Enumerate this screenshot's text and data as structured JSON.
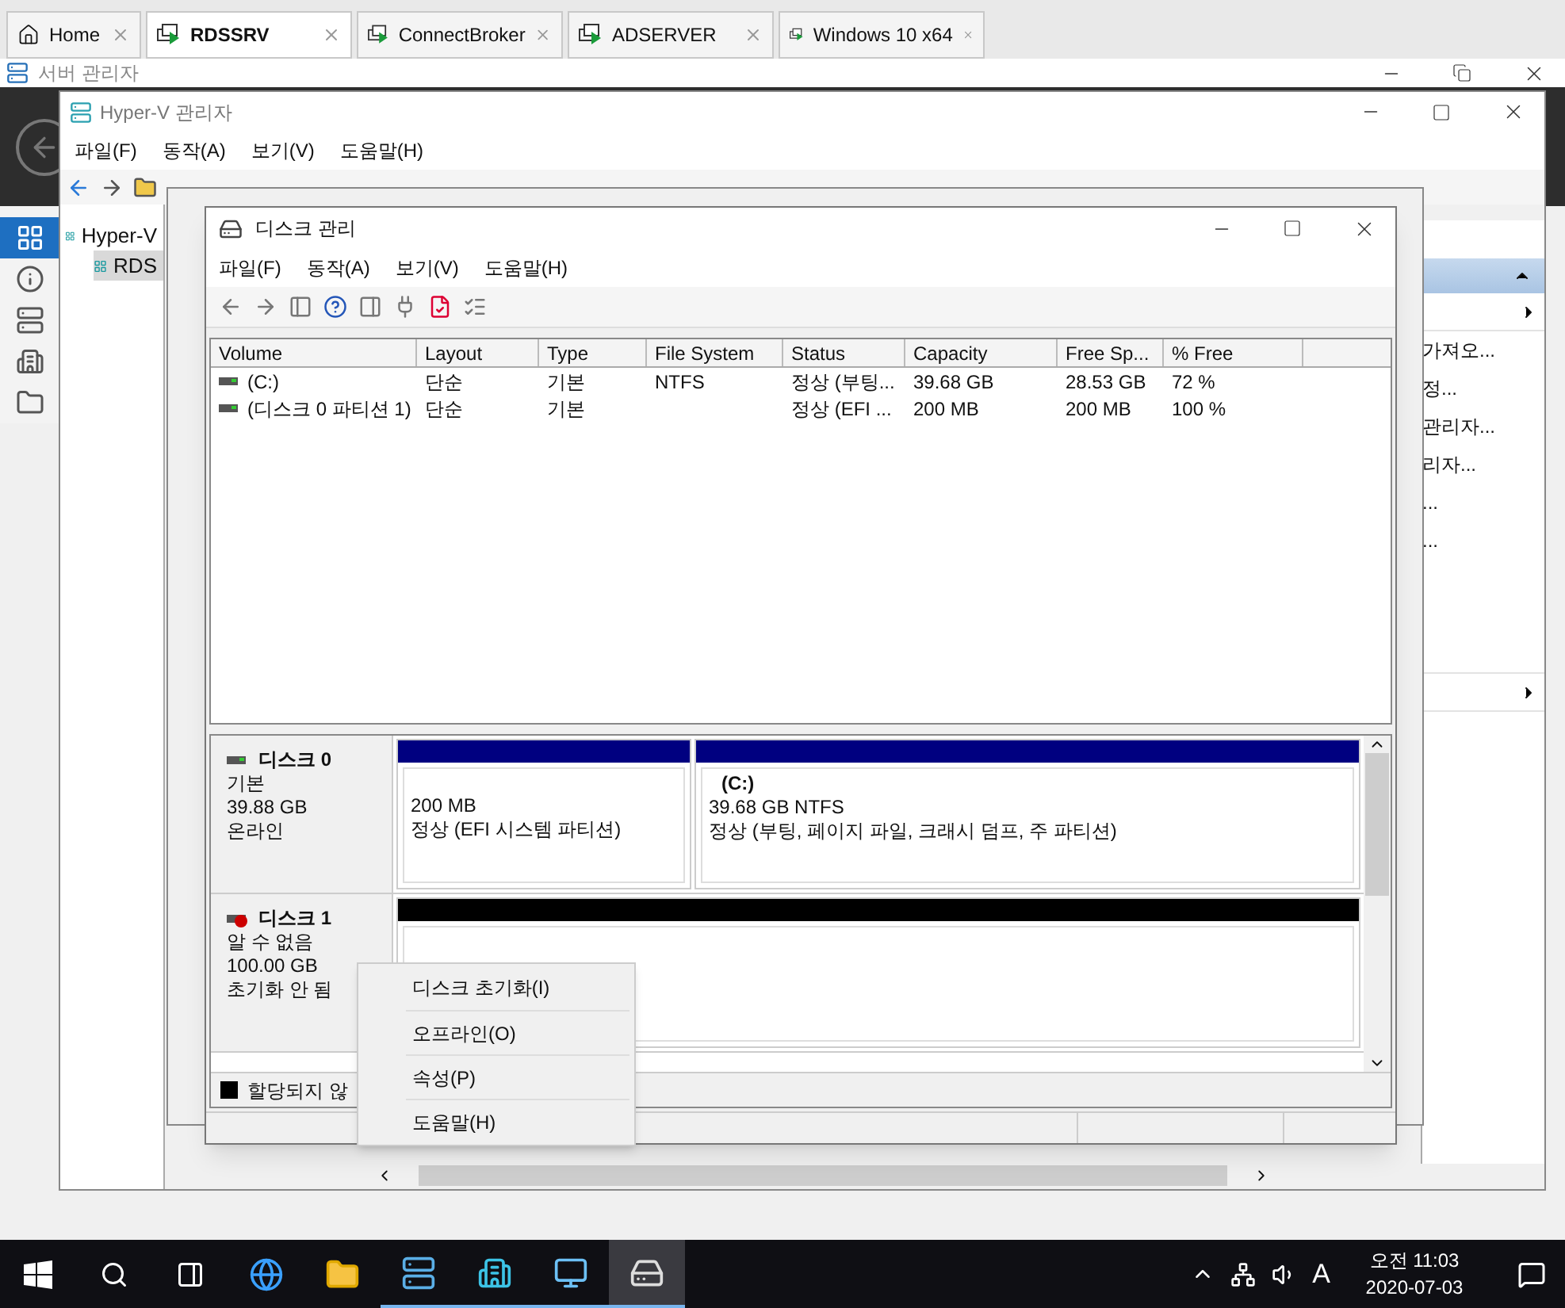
{
  "tabs": [
    {
      "label": "Home",
      "kind": "home",
      "selected": false
    },
    {
      "label": "RDSSRV",
      "kind": "vm",
      "selected": true
    },
    {
      "label": "ConnectBroker",
      "kind": "vm",
      "selected": false
    },
    {
      "label": "ADSERVER",
      "kind": "vm",
      "selected": false
    },
    {
      "label": "Windows 10 x64",
      "kind": "vm",
      "selected": false
    }
  ],
  "server_manager": {
    "title": "서버 관리자",
    "nav": [
      {
        "kind": "dashboard",
        "selected": true
      },
      {
        "kind": "local",
        "selected": false
      },
      {
        "kind": "all",
        "selected": false
      },
      {
        "kind": "role",
        "selected": false
      },
      {
        "kind": "files",
        "selected": false
      }
    ]
  },
  "hyperv": {
    "title": "Hyper-V 관리자",
    "menu": [
      "파일(F)",
      "동작(A)",
      "보기(V)",
      "도움말(H)"
    ],
    "tree": [
      {
        "label": "Hyper-V",
        "selected": false,
        "children": [
          {
            "label": "RDS",
            "selected": true
          }
        ]
      }
    ],
    "actions": [
      {
        "kind": "header"
      },
      {
        "kind": "submenu"
      },
      {
        "kind": "item",
        "label": "가져오..."
      },
      {
        "kind": "item",
        "label": "정..."
      },
      {
        "kind": "item",
        "label": "관리자..."
      },
      {
        "kind": "item",
        "label": "리자..."
      },
      {
        "kind": "item",
        "label": "..."
      },
      {
        "kind": "item",
        "label": "..."
      },
      {
        "kind": "spacer"
      },
      {
        "kind": "submenu"
      }
    ]
  },
  "disk_management": {
    "title": "디스크 관리",
    "menu": [
      "파일(F)",
      "동작(A)",
      "보기(V)",
      "도움말(H)"
    ],
    "columns": [
      "Volume",
      "Layout",
      "Type",
      "File System",
      "Status",
      "Capacity",
      "Free Sp...",
      "% Free"
    ],
    "rows": [
      [
        "(C:)",
        "단순",
        "기본",
        "NTFS",
        "정상 (부팅...",
        "39.68 GB",
        "28.53 GB",
        "72 %"
      ],
      [
        "(디스크 0 파티션 1)",
        "단순",
        "기본",
        "",
        "정상 (EFI ...",
        "200 MB",
        "200 MB",
        "100 %"
      ]
    ],
    "disks": [
      {
        "name": "디스크 0",
        "kind": "online",
        "type": "기본",
        "size": "39.88 GB",
        "state": "온라인",
        "partitions": [
          {
            "kind": "primary",
            "size": "200 MB",
            "status": "정상 (EFI 시스템 파티션)"
          },
          {
            "kind": "primary",
            "label": "(C:)",
            "size": "39.68 GB NTFS",
            "status": "정상 (부팅, 페이지 파일, 크래시 덤프, 주 파티션)"
          }
        ]
      },
      {
        "name": "디스크 1",
        "kind": "error",
        "type": "알 수 없음",
        "size": "100.00 GB",
        "state": "초기화 안 됨",
        "partitions": [
          {
            "kind": "unallocated"
          }
        ]
      }
    ],
    "legend": [
      {
        "label": "할당되지 않",
        "color": "#000000"
      }
    ]
  },
  "context_menu": [
    {
      "label": "디스크 초기화(I)"
    },
    {
      "label": "오프라인(O)"
    },
    {
      "label": "속성(P)"
    },
    {
      "label": "도움말(H)"
    }
  ],
  "taskbar": {
    "apps": [
      {
        "kind": "start",
        "running": false,
        "selected": false
      },
      {
        "kind": "search",
        "running": false,
        "selected": false
      },
      {
        "kind": "taskview",
        "running": false,
        "selected": false
      },
      {
        "kind": "ie",
        "running": false,
        "selected": false
      },
      {
        "kind": "explorer",
        "running": false,
        "selected": false
      },
      {
        "kind": "servermanager",
        "running": true,
        "selected": false
      },
      {
        "kind": "hyperv",
        "running": true,
        "selected": false
      },
      {
        "kind": "remote",
        "running": true,
        "selected": false
      },
      {
        "kind": "disk",
        "running": true,
        "selected": true
      }
    ],
    "ime": "A",
    "time": "오전 11:03",
    "date": "2020-07-03"
  }
}
